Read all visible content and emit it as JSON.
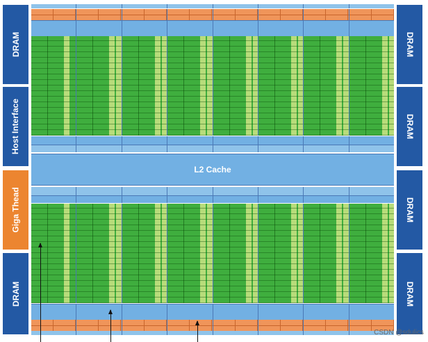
{
  "left_blocks": [
    {
      "label": "DRAM",
      "color": "#2359a4"
    },
    {
      "label": "Host Interface",
      "color": "#2359a4"
    },
    {
      "label": "Giga Thead",
      "color": "#ec8530"
    },
    {
      "label": "DRAM",
      "color": "#2359a4"
    }
  ],
  "right_blocks": [
    {
      "label": "DRAM"
    },
    {
      "label": "DRAM"
    },
    {
      "label": "DRAM"
    },
    {
      "label": "DRAM"
    }
  ],
  "center": {
    "l2_label": "L2 Cache"
  },
  "colors": {
    "dram": "#2359a4",
    "giga_thread": "#ec8530",
    "sm_core": "#3fae3e",
    "sm_light": "#b8dc7a",
    "cache": "#72b0e3",
    "scheduler": "#f0955a"
  },
  "watermark": "CSDN @sdulics"
}
